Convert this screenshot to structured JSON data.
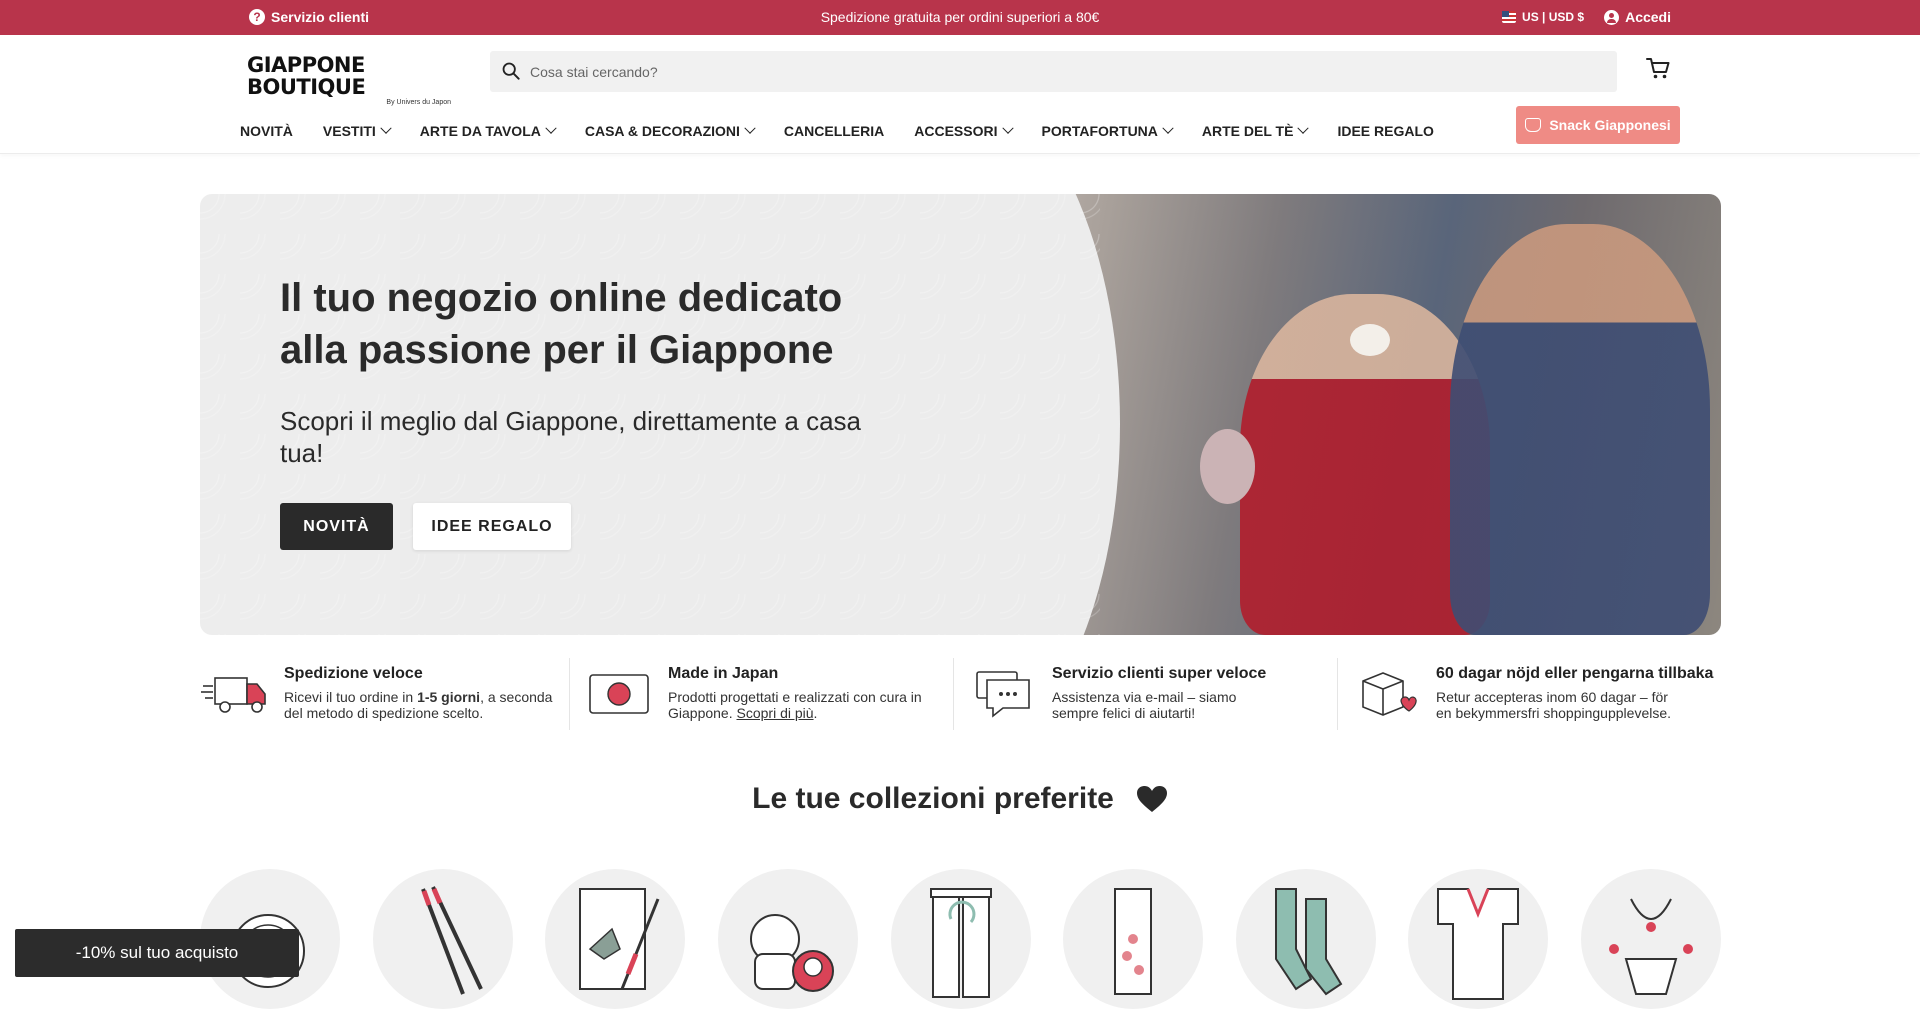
{
  "topbar": {
    "help_label": "Servizio clienti",
    "announcement": "Spedizione gratuita per ordini superiori a 80€",
    "locale_label": "US | USD $",
    "login_label": "Accedi"
  },
  "header": {
    "logo_text": "GIAPPONE BOUTIQUE",
    "logo_subtext": "By Univers du Japon",
    "search_placeholder": "Cosa stai cercando?",
    "snack_button": "Snack Giapponesi"
  },
  "nav": {
    "items": [
      {
        "label": "NOVITÀ",
        "dropdown": false
      },
      {
        "label": "VESTITI",
        "dropdown": true
      },
      {
        "label": "ARTE DA TAVOLA",
        "dropdown": true
      },
      {
        "label": "CASA & DECORAZIONI",
        "dropdown": true
      },
      {
        "label": "CANCELLERIA",
        "dropdown": false
      },
      {
        "label": "ACCESSORI",
        "dropdown": true
      },
      {
        "label": "PORTAFORTUNA",
        "dropdown": true
      },
      {
        "label": "ARTE DEL TÈ",
        "dropdown": true
      },
      {
        "label": "IDEE REGALO",
        "dropdown": false
      }
    ]
  },
  "hero": {
    "title": "Il tuo negozio online dedicato alla passione per il Giappone",
    "subtitle": "Scopri il meglio dal Giappone, direttamente a casa tua!",
    "primary_button": "NOVITÀ",
    "secondary_button": "IDEE REGALO"
  },
  "features": [
    {
      "icon": "delivery-truck-icon",
      "title": "Spedizione veloce",
      "desc_prefix": "Ricevi il tuo ordine in ",
      "desc_bold": "1-5 giorni",
      "desc_suffix": ", a seconda del metodo di spedizione scelto."
    },
    {
      "icon": "japan-flag-icon",
      "title": "Made in Japan",
      "desc_prefix": "Prodotti progettati e realizzati con cura in Giappone. ",
      "link": "Scopri di più",
      "desc_suffix": "."
    },
    {
      "icon": "chat-bubbles-icon",
      "title": "Servizio clienti super veloce",
      "desc": "Assistenza via e-mail – siamo sempre felici di aiutarti!"
    },
    {
      "icon": "return-box-icon",
      "title": "60 dagar nöjd eller pengarna tillbaka",
      "desc": "Retur accepteras inom 60 dagar – för en bekymmersfri shoppingupplevelse."
    }
  ],
  "collections": {
    "title": "Le tue collezioni preferite",
    "items": [
      {
        "icon": "plate-icon"
      },
      {
        "icon": "chopsticks-icon"
      },
      {
        "icon": "origami-stationery-icon"
      },
      {
        "icon": "maneki-neko-daruma-icon"
      },
      {
        "icon": "noren-curtain-icon"
      },
      {
        "icon": "tenugui-towel-icon"
      },
      {
        "icon": "tabi-socks-icon"
      },
      {
        "icon": "kimono-icon"
      },
      {
        "icon": "jewelry-icon"
      }
    ]
  },
  "promo": {
    "label": "-10% sul tuo acquisto"
  },
  "colors": {
    "topbar": "#b8344b",
    "snack_button": "#ef8b85",
    "dark": "#2a2a2a",
    "accent_red": "#d94357"
  }
}
